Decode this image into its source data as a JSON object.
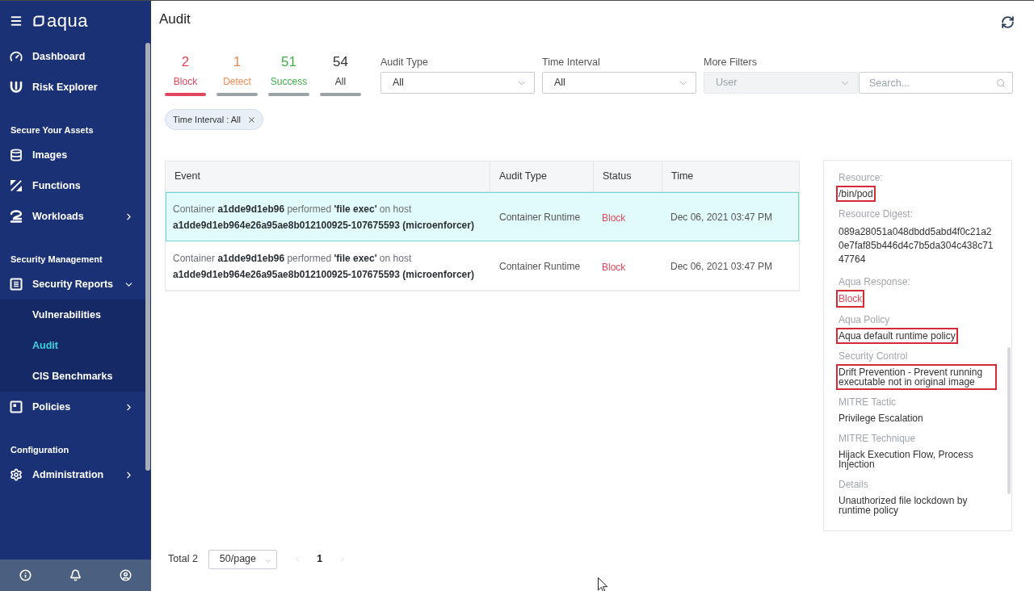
{
  "sidebar": {
    "logo": "aqua",
    "nav": [
      {
        "kind": "item",
        "label": "Dashboard"
      },
      {
        "kind": "item",
        "label": "Risk Explorer"
      },
      {
        "kind": "heading",
        "label": "Secure Your Assets"
      },
      {
        "kind": "item",
        "label": "Images"
      },
      {
        "kind": "item",
        "label": "Functions"
      },
      {
        "kind": "item",
        "label": "Workloads",
        "expanded": false
      },
      {
        "kind": "heading",
        "label": "Security Management"
      },
      {
        "kind": "item",
        "label": "Security Reports",
        "expanded": true,
        "children": [
          {
            "label": "Vulnerabilities",
            "selected": false
          },
          {
            "label": "Audit",
            "selected": true
          },
          {
            "label": "CIS Benchmarks",
            "selected": false
          }
        ]
      },
      {
        "kind": "item",
        "label": "Policies",
        "expanded": false
      },
      {
        "kind": "heading",
        "label": "Configuration"
      },
      {
        "kind": "item",
        "label": "Administration",
        "expanded": false
      }
    ]
  },
  "page": {
    "title": "Audit"
  },
  "stats": [
    {
      "count": "2",
      "label": "Block",
      "color": "#e0475a",
      "selected": true
    },
    {
      "count": "1",
      "label": "Detect",
      "color": "#ef8a4f",
      "selected": false
    },
    {
      "count": "51",
      "label": "Success",
      "color": "#3fae49",
      "selected": false
    },
    {
      "count": "54",
      "label": "All",
      "color": "#333333",
      "selected": false
    }
  ],
  "filters": [
    {
      "label": "Audit Type",
      "controls": [
        {
          "kind": "select",
          "value": "All",
          "disabled": false
        }
      ]
    },
    {
      "label": "Time Interval",
      "controls": [
        {
          "kind": "select",
          "value": "All",
          "disabled": false
        }
      ]
    },
    {
      "label": "More Filters",
      "controls": [
        {
          "kind": "select",
          "placeholder": "User",
          "disabled": true
        },
        {
          "kind": "search",
          "placeholder": "Search...",
          "disabled": false
        }
      ]
    }
  ],
  "chips": [
    {
      "label": "Time Interval : All"
    }
  ],
  "table": {
    "columns": [
      "Event",
      "Audit Type",
      "Status",
      "Time"
    ],
    "rows": [
      {
        "event": "Container **a1dde9d1eb96** performed **'file exec'** on host **a1dde9d1eb964e26a95ae8b012100925-107675593 (microenforcer)**",
        "audit_type": "Container Runtime",
        "status": "Block",
        "time": "Dec 06, 2021 03:47 PM",
        "selected": true
      },
      {
        "event": "Container **a1dde9d1eb96** performed **'file exec'** on host **a1dde9d1eb964e26a95ae8b012100925-107675593 (microenforcer)**",
        "audit_type": "Container Runtime",
        "status": "Block",
        "time": "Dec 06, 2021 03:47 PM",
        "selected": false
      }
    ]
  },
  "details": {
    "fields": [
      {
        "label": "Resource:",
        "value": "/bin/pod",
        "kind": "text",
        "highlighted": true
      },
      {
        "label": "Resource Digest:",
        "value": "089a28051a048dbdd5abd4f0c21a20e7faf85b446d4c7b5da304c438c7147764",
        "kind": "digest",
        "highlighted": false
      },
      {
        "label": "Aqua Response:",
        "value": "Block",
        "kind": "status",
        "highlighted": true
      },
      {
        "label": "Aqua Policy",
        "value": "Aqua default runtime policy",
        "kind": "text",
        "highlighted": true
      },
      {
        "label": "Security Control",
        "value": "Drift Prevention - Prevent running executable not in original image",
        "kind": "text",
        "highlighted": true
      },
      {
        "label": "MITRE Tactic",
        "value": "Privilege Escalation",
        "kind": "text",
        "highlighted": false
      },
      {
        "label": "MITRE Technique",
        "value": "Hijack Execution Flow, Process Injection",
        "kind": "text",
        "highlighted": false
      },
      {
        "label": "Details",
        "value": "Unauthorized file lockdown by runtime policy",
        "kind": "text",
        "highlighted": false
      }
    ]
  },
  "pagination": {
    "total": "Total 2",
    "page_size": "50/page",
    "prev": {
      "disabled": true
    },
    "pages": [
      {
        "label": "1",
        "selected": true
      }
    ],
    "next": {
      "disabled": true
    }
  }
}
